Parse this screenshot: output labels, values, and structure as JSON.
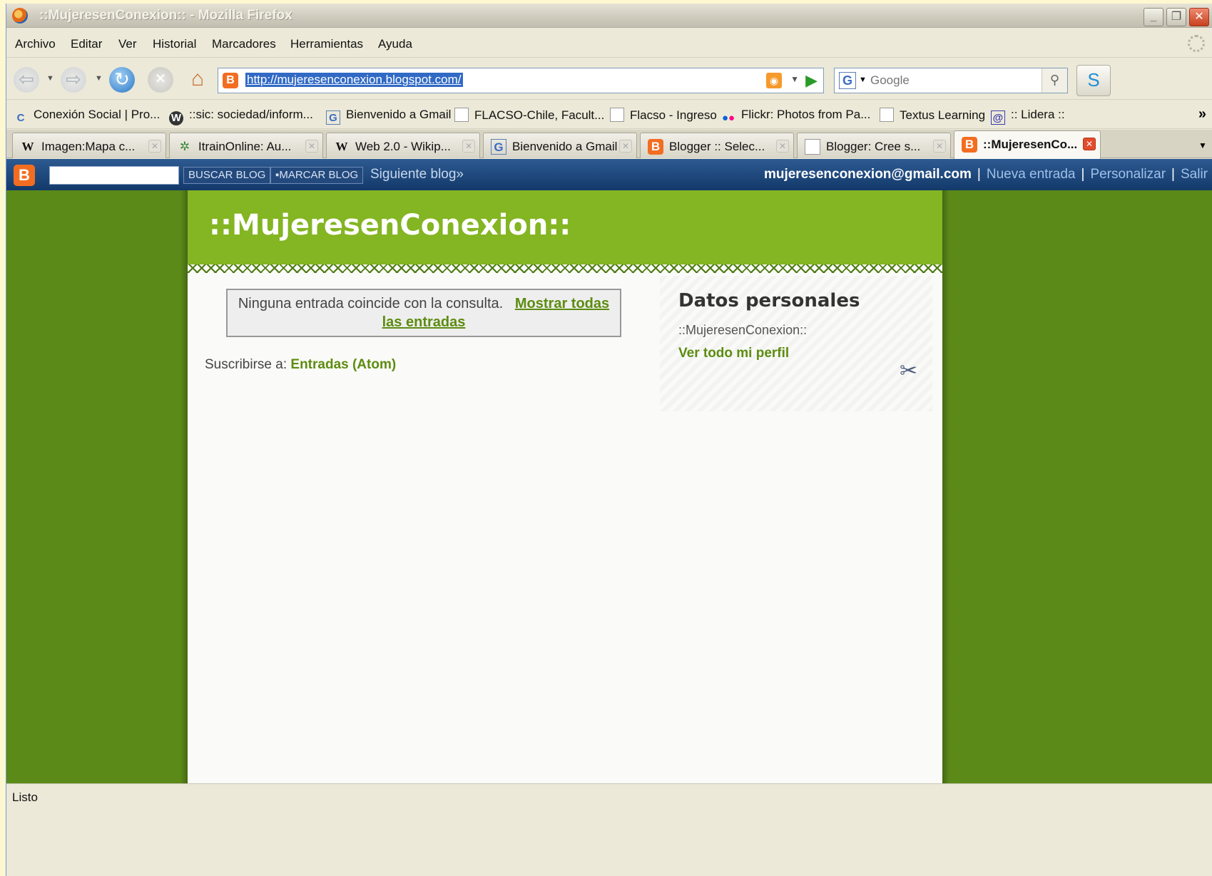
{
  "window": {
    "title": "::MujeresenConexion:: - Mozilla Firefox"
  },
  "menu": [
    "Archivo",
    "Editar",
    "Ver",
    "Historial",
    "Marcadores",
    "Herramientas",
    "Ayuda"
  ],
  "nav": {
    "url": "http://mujeresenconexion.blogspot.com/",
    "search_placeholder": "Google"
  },
  "bookmarks": [
    "Conexión Social | Pro...",
    "::sic: sociedad/inform...",
    "Bienvenido a Gmail",
    "FLACSO-Chile, Facult...",
    "Flacso - Ingreso",
    "Flickr: Photos from Pa...",
    "Textus Learning",
    ":: Lidera ::"
  ],
  "tabs": [
    "Imagen:Mapa c...",
    "ItrainOnline: Au...",
    "Web 2.0 - Wikip...",
    "Bienvenido a Gmail",
    "Blogger :: Selec...",
    "Blogger: Cree s...",
    "::MujeresenCo..."
  ],
  "blogger_bar": {
    "search_button": "BUSCAR BLOG",
    "flag_button": "MARCAR BLOG",
    "next_blog": "Siguiente blog»",
    "email": "mujeresenconexion@gmail.com",
    "new_post": "Nueva entrada",
    "customize": "Personalizar",
    "sign_out": "Salir"
  },
  "blog": {
    "title": "::MujeresenConexion::",
    "no_results": "Ninguna entrada coincide con la consulta.",
    "show_all": "Mostrar todas las entradas",
    "subscribe_label": "Suscribirse a:",
    "subscribe_link": "Entradas (Atom)",
    "profile_heading": "Datos personales",
    "profile_name": "::MujeresenConexion::",
    "profile_link": "Ver todo mi perfil"
  },
  "status": "Listo",
  "colors": {
    "page_bg": "#5b8a19",
    "header_green": "#84b522",
    "link_green": "#5d8c10",
    "blogger_bar": "#1e4677"
  }
}
